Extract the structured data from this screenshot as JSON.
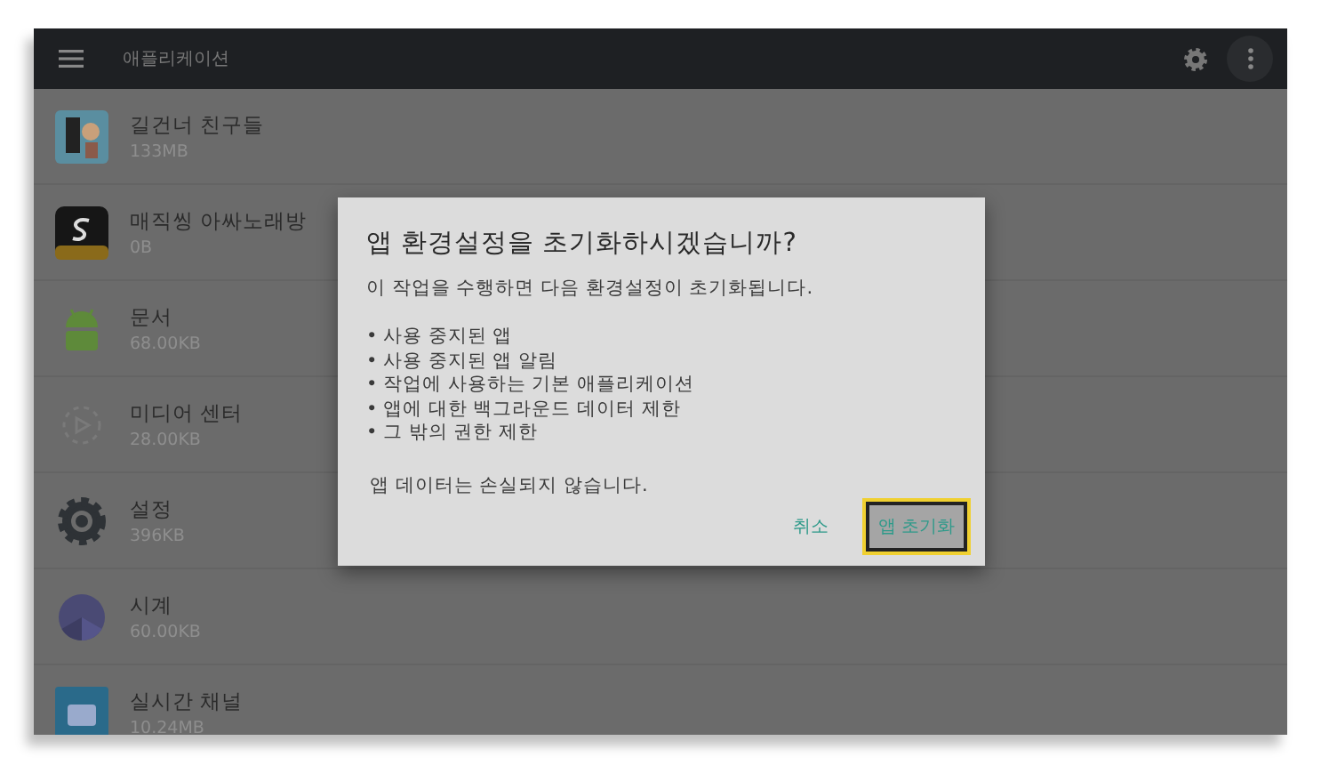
{
  "top_bar": {
    "title": "애플리케이션"
  },
  "apps": [
    {
      "name": "길건너 친구들",
      "size": "133MB"
    },
    {
      "name": "매직씽 아싸노래방",
      "size": "0B"
    },
    {
      "name": "문서",
      "size": "68.00KB"
    },
    {
      "name": "미디어 센터",
      "size": "28.00KB"
    },
    {
      "name": "설정",
      "size": "396KB"
    },
    {
      "name": "시계",
      "size": "60.00KB"
    },
    {
      "name": "실시간 채널",
      "size": "10.24MB"
    }
  ],
  "dialog": {
    "title": "앱 환경설정을 초기화하시겠습니까?",
    "message": "이 작업을 수행하면 다음 환경설정이 초기화됩니다.",
    "bullets": [
      "• 사용 중지된 앱",
      "• 사용 중지된 앱 알림",
      "• 작업에 사용하는 기본 애플리케이션",
      "• 앱에 대한 백그라운드 데이터 제한",
      "• 그 밖의 권한 제한"
    ],
    "note": "앱 데이터는 손실되지 않습니다.",
    "buttons": [
      {
        "label": "취소",
        "focused": false
      },
      {
        "label": "앱 초기화",
        "focused": true
      }
    ]
  }
}
